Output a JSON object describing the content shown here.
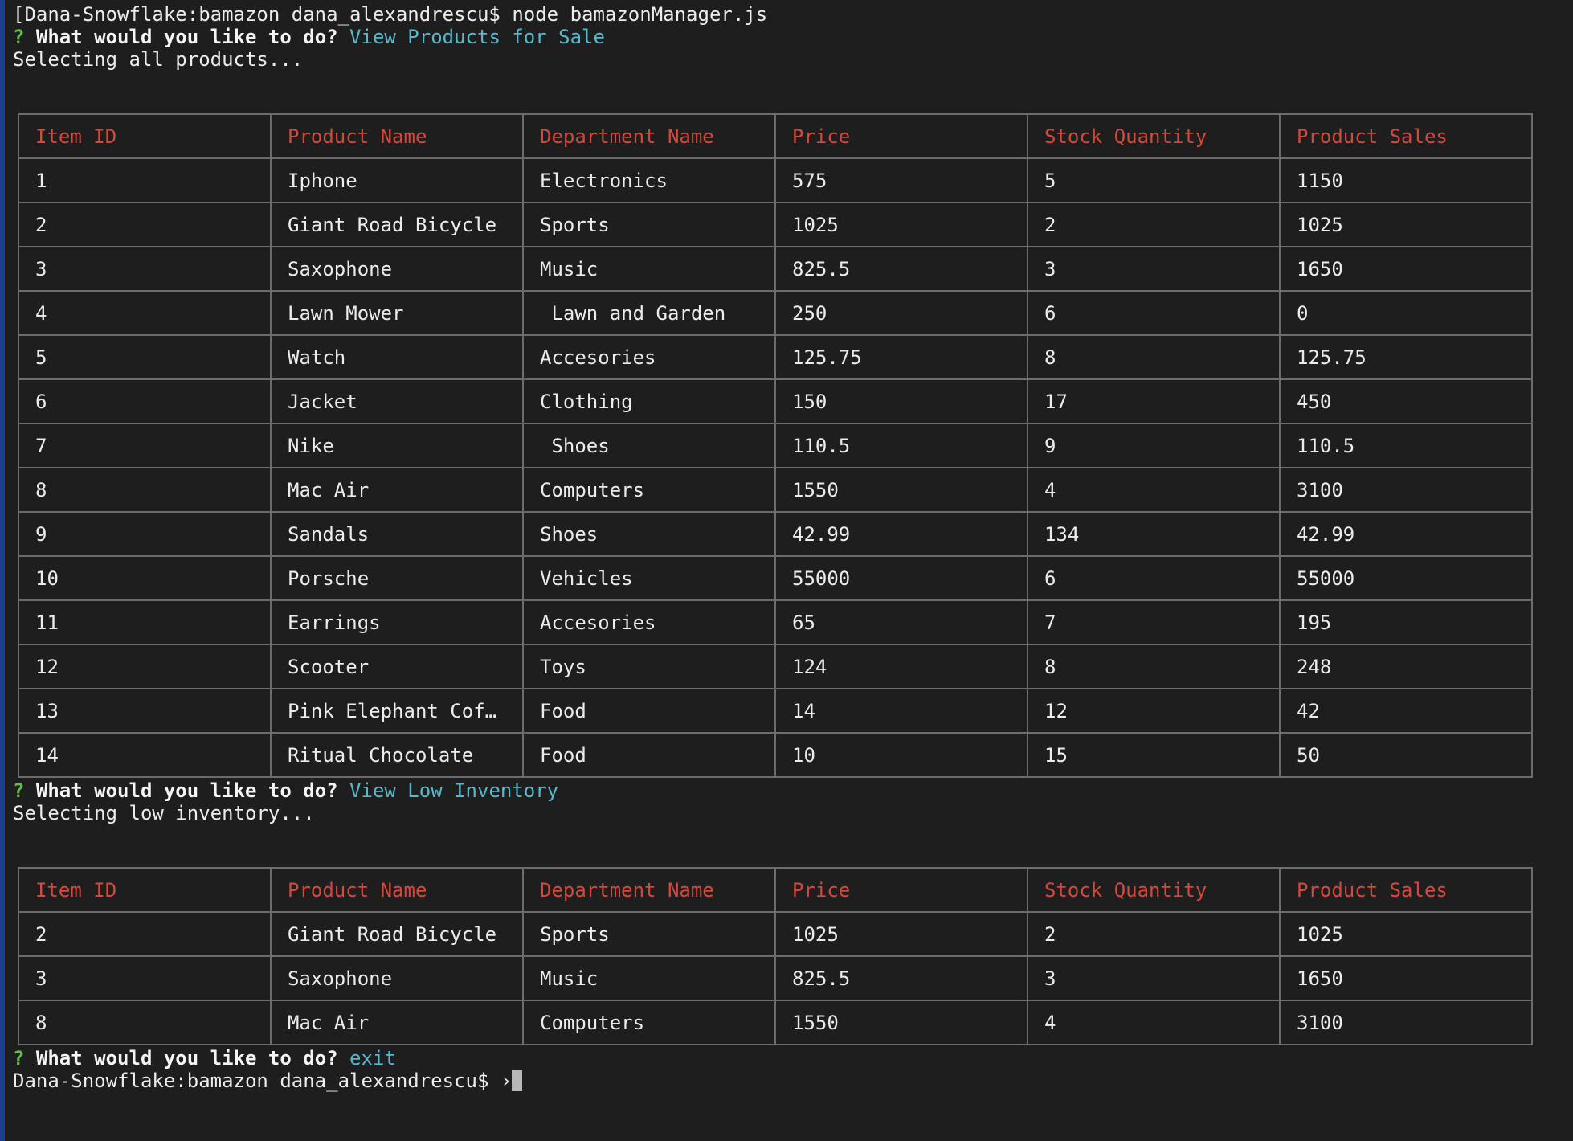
{
  "session": {
    "command_line": "[Dana-Snowflake:bamazon dana_alexandrescu$ node bamazonManager.js",
    "final_prompt": "Dana-Snowflake:bamazon dana_alexandrescu$ ›"
  },
  "prompt": {
    "mark": "?",
    "question": "What would you like to do?"
  },
  "columns": [
    "Item ID",
    "Product Name",
    "Department Name",
    "Price",
    "Stock Quantity",
    "Product Sales"
  ],
  "sections": [
    {
      "answer": "View Products for Sale",
      "status": "Selecting all products...",
      "rows": [
        [
          "1",
          "Iphone",
          "Electronics",
          "575",
          "5",
          "1150"
        ],
        [
          "2",
          "Giant Road Bicycle",
          "Sports",
          "1025",
          "2",
          "1025"
        ],
        [
          "3",
          "Saxophone",
          "Music",
          "825.5",
          "3",
          "1650"
        ],
        [
          "4",
          "Lawn Mower",
          " Lawn and Garden",
          "250",
          "6",
          "0"
        ],
        [
          "5",
          "Watch",
          "Accesories",
          "125.75",
          "8",
          "125.75"
        ],
        [
          "6",
          "Jacket",
          "Clothing",
          "150",
          "17",
          "450"
        ],
        [
          "7",
          "Nike",
          " Shoes",
          "110.5",
          "9",
          "110.5"
        ],
        [
          "8",
          "Mac Air",
          "Computers",
          "1550",
          "4",
          "3100"
        ],
        [
          "9",
          "Sandals",
          "Shoes",
          "42.99",
          "134",
          "42.99"
        ],
        [
          "10",
          "Porsche",
          "Vehicles",
          "55000",
          "6",
          "55000"
        ],
        [
          "11",
          "Earrings",
          "Accesories",
          "65",
          "7",
          "195"
        ],
        [
          "12",
          "Scooter",
          "Toys",
          "124",
          "8",
          "248"
        ],
        [
          "13",
          "Pink Elephant Cof…",
          "Food",
          "14",
          "12",
          "42"
        ],
        [
          "14",
          "Ritual Chocolate",
          "Food",
          "10",
          "15",
          "50"
        ]
      ]
    },
    {
      "answer": "View Low Inventory",
      "status": "Selecting low inventory...",
      "rows": [
        [
          "2",
          "Giant Road Bicycle",
          "Sports",
          "1025",
          "2",
          "1025"
        ],
        [
          "3",
          "Saxophone",
          "Music",
          "825.5",
          "3",
          "1650"
        ],
        [
          "8",
          "Mac Air",
          "Computers",
          "1550",
          "4",
          "3100"
        ]
      ]
    },
    {
      "answer": "exit"
    }
  ]
}
